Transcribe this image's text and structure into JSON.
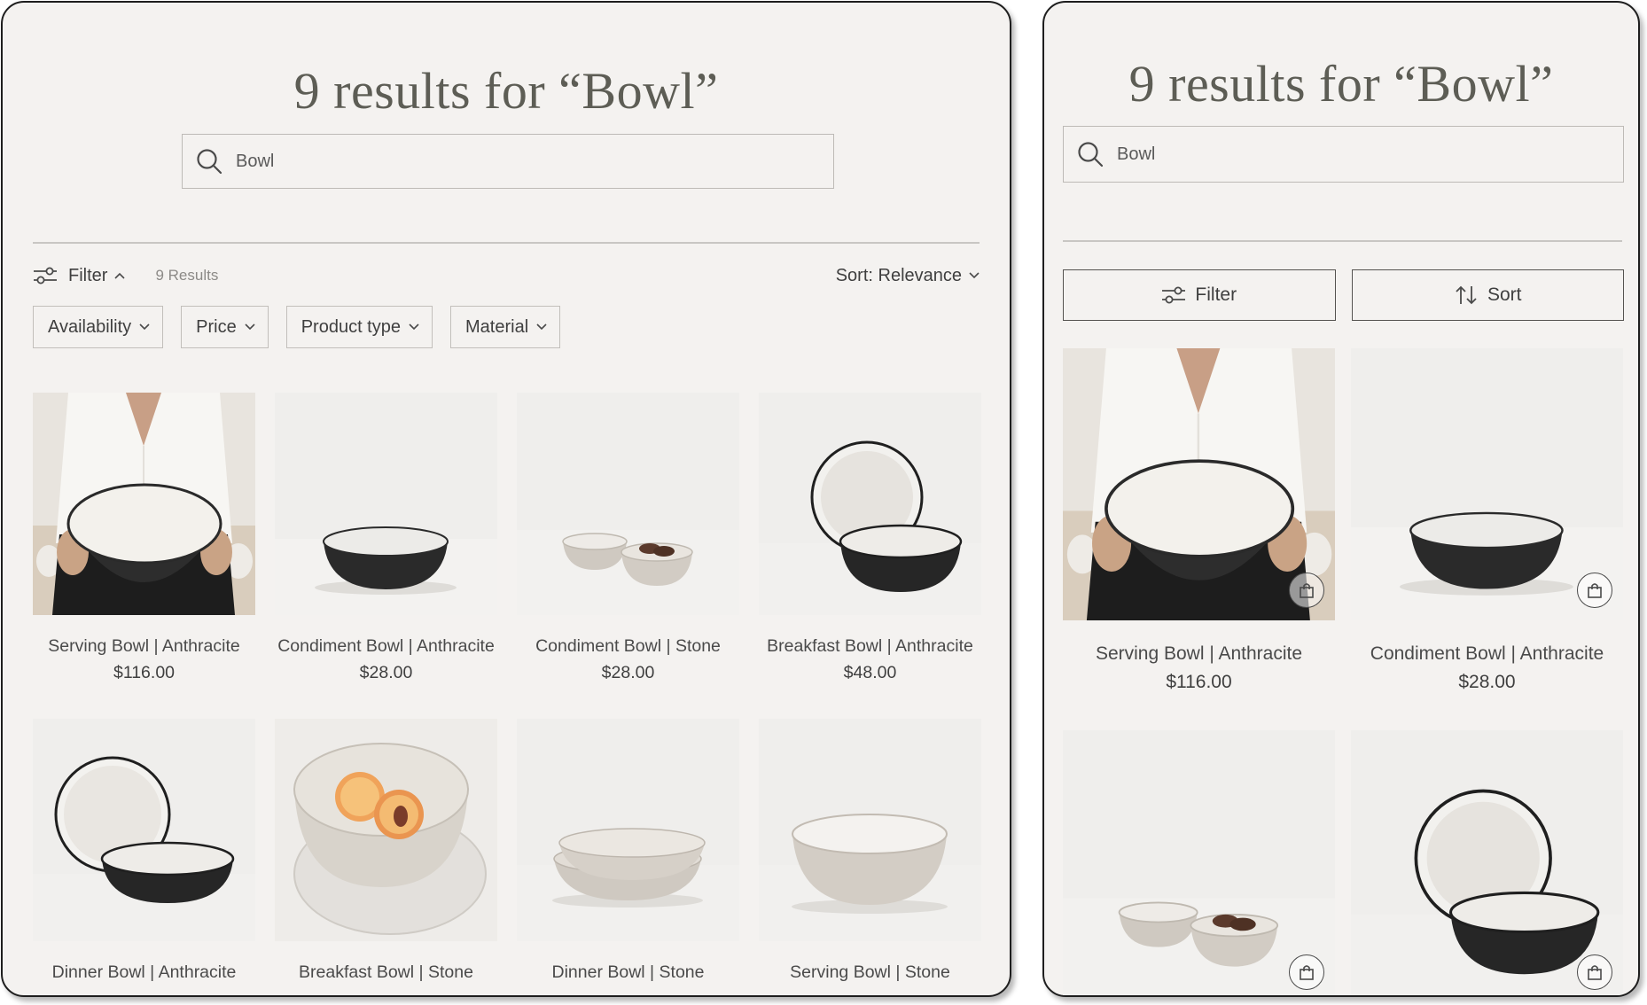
{
  "desktop": {
    "title": "9 results for “Bowl”",
    "search_value": "Bowl",
    "filter_label": "Filter",
    "results_count": "9 Results",
    "sort_label": "Sort: Relevance",
    "facets": [
      "Availability",
      "Price",
      "Product type",
      "Material"
    ],
    "products": [
      {
        "name": "Serving Bowl | Anthracite",
        "price": "$116.00"
      },
      {
        "name": "Condiment Bowl | Anthracite",
        "price": "$28.00"
      },
      {
        "name": "Condiment Bowl | Stone",
        "price": "$28.00"
      },
      {
        "name": "Breakfast Bowl | Anthracite",
        "price": "$48.00"
      },
      {
        "name": "Dinner Bowl | Anthracite",
        "price": ""
      },
      {
        "name": "Breakfast Bowl | Stone",
        "price": ""
      },
      {
        "name": "Dinner Bowl | Stone",
        "price": ""
      },
      {
        "name": "Serving Bowl | Stone",
        "price": ""
      }
    ]
  },
  "mobile": {
    "title": "9 results for “Bowl”",
    "search_value": "Bowl",
    "filter_label": "Filter",
    "sort_label": "Sort",
    "products": [
      {
        "name": "Serving Bowl | Anthracite",
        "price": "$116.00"
      },
      {
        "name": "Condiment Bowl | Anthracite",
        "price": "$28.00"
      },
      {
        "name": "",
        "price": ""
      },
      {
        "name": "",
        "price": ""
      }
    ]
  },
  "colors": {
    "background": "#f4f2f0",
    "title": "#5d5d55",
    "text": "#3f3f3f",
    "anthracite": "#2c2c2c",
    "stone": "#d8d3cc"
  },
  "icons": [
    "search-icon",
    "sliders-icon",
    "chevron-up-icon",
    "chevron-down-icon",
    "sort-arrows-icon",
    "shopping-bag-icon"
  ]
}
